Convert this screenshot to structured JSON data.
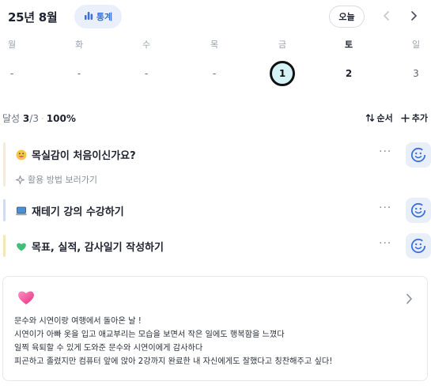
{
  "header": {
    "month_title": "25년 8월",
    "stats_label": "통계",
    "today_label": "오늘"
  },
  "week": {
    "days": [
      {
        "name": "월",
        "value": "-"
      },
      {
        "name": "화",
        "value": "-"
      },
      {
        "name": "수",
        "value": "-"
      },
      {
        "name": "목",
        "value": "-"
      },
      {
        "name": "금",
        "value": "1"
      },
      {
        "name": "토",
        "value": "2"
      },
      {
        "name": "일",
        "value": "3"
      }
    ]
  },
  "achievement": {
    "label": "달성",
    "done": "3",
    "total": "/3",
    "percent": "100%",
    "order_label": "순서",
    "add_label": "추가"
  },
  "goals": [
    {
      "title": "목실감이 처음이신가요?",
      "emoji": "grinning-face",
      "bar_color": "#f3ecdb",
      "sub": "활용 방법 보러가기"
    },
    {
      "title": "재테기 강의 수강하기",
      "emoji": "laptop",
      "bar_color": "#cfdcf4"
    },
    {
      "title": "목표, 실적, 감사일기 작성하기",
      "emoji": "green-heart",
      "bar_color": "#f6e6b6"
    }
  ],
  "diary": {
    "lines": [
      "문수와 시연이랑 여행에서 돌아온 날 !",
      "시연이가 아빠 옷을 입고 애교부리는 모습을 보면서 작은 일에도 행복함을 느꼈다",
      "일찍 육퇴할 수 있게 도와준 문수와 시연이에게 감사하다",
      "피곤하고 졸렸지만 컴퓨터 앞에 앉아 2강까지 완료한 내 자신에게도 잘했다고 칭찬해주고 싶다!"
    ]
  },
  "colors": {
    "accent": "#3b6fe0",
    "today_fill": "#d5f2f6",
    "check_bg": "#e9eff9"
  }
}
